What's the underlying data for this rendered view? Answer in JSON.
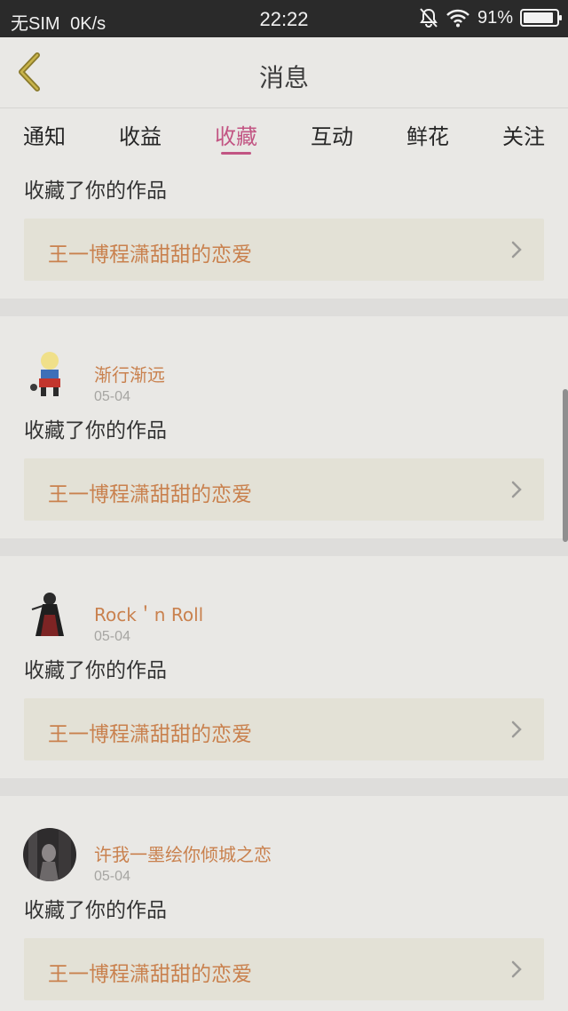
{
  "status_bar": {
    "carrier": "无SIM",
    "speed": "0K/s",
    "time": "22:22",
    "battery": "91%",
    "battery_level": 0.91,
    "icons": [
      "bell-off-icon",
      "wifi-icon",
      "battery-icon"
    ]
  },
  "nav": {
    "title": "消息",
    "back_icon": "chevron-left-icon"
  },
  "tabs": [
    {
      "label": "通知",
      "active": false
    },
    {
      "label": "收益",
      "active": false
    },
    {
      "label": "收藏",
      "active": true
    },
    {
      "label": "互动",
      "active": false
    },
    {
      "label": "鲜花",
      "active": false
    },
    {
      "label": "关注",
      "active": false
    }
  ],
  "colors": {
    "accent": "#c25583",
    "username": "#c9814e",
    "background": "#e9e8e5",
    "work_box": "#e3e1d6"
  },
  "feed": [
    {
      "username": "",
      "date": "",
      "action": "收藏了你的作品",
      "work_title": "王一博程潇甜甜的恋爱"
    },
    {
      "username": "渐行渐远",
      "date": "05-04",
      "action": "收藏了你的作品",
      "work_title": "王一博程潇甜甜的恋爱"
    },
    {
      "username": "Rock＇n Roll",
      "date": "05-04",
      "action": "收藏了你的作品",
      "work_title": "王一博程潇甜甜的恋爱"
    },
    {
      "username": "许我一墨绘你倾城之恋",
      "date": "05-04",
      "action": "收藏了你的作品",
      "work_title": "王一博程潇甜甜的恋爱"
    }
  ]
}
